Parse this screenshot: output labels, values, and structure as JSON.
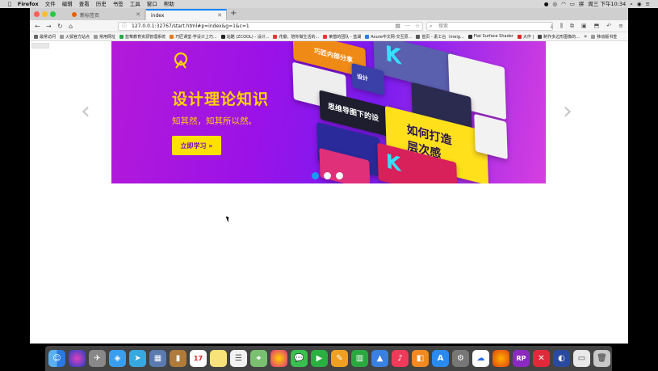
{
  "menubar": {
    "apple": "",
    "items": [
      "Firefox",
      "文件",
      "编辑",
      "查看",
      "历史",
      "书签",
      "工具",
      "窗口",
      "帮助"
    ],
    "clock": "周三 下午10:34"
  },
  "tabs": [
    {
      "label": "新标签页",
      "active": false
    },
    {
      "label": "index",
      "active": true
    }
  ],
  "nav": {
    "url": "127.0.0.1:32767/start.html#p=index&g=1&c=1",
    "search_placeholder": "搜索"
  },
  "bookmarks": [
    "最常访问",
    "火狐官方站点",
    "常用网址",
    "蓝莓教育资源管理系统",
    "巧匠课堂-学设计上巧...",
    "站酷 (ZCOOL) - 设计...",
    "花瓣，陪你做生活的...",
    "莱茵的团队 - 蓝湖",
    "Axure中文网-交互原...",
    "首页 - 素工台（meig...",
    "Flat Surface Shader",
    "大作 |",
    "制作多边形图像的..."
  ],
  "bookmarks_overflow": "移动版书签",
  "banner": {
    "title": "设计理论知识",
    "subtitle": "知其然，知其所以然。",
    "cta": "立即学习 »",
    "cards": [
      "巧匠内部分享",
      "如何打造",
      "层次感",
      "思维导图下的设",
      "设计",
      "K"
    ]
  },
  "carousel": {
    "slides": 3,
    "active_index": 0
  },
  "colors": {
    "accent": "#1a9cf0",
    "highlight": "#ffd400",
    "banner_purple": "#9a12e8"
  }
}
